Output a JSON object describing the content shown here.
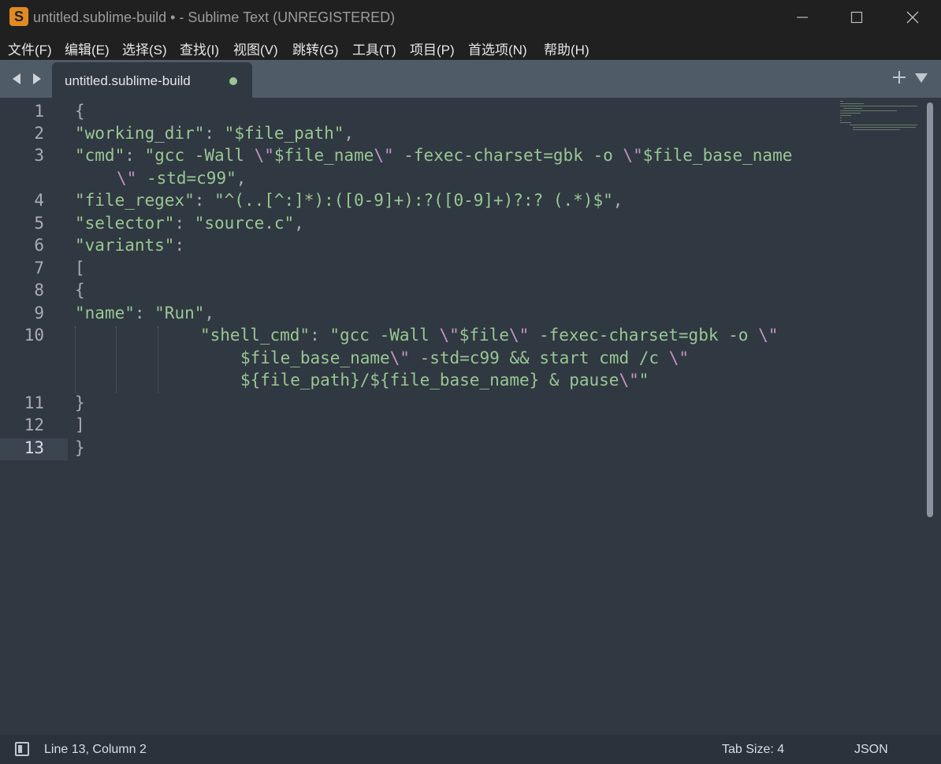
{
  "window": {
    "title": "untitled.sublime-build • - Sublime Text (UNREGISTERED)",
    "app_icon_glyph": "S"
  },
  "menu": [
    "文件(F)",
    "编辑(E)",
    "选择(S)",
    "查找(I)",
    "视图(V)",
    "跳转(G)",
    "工具(T)",
    "项目(P)",
    "首选项(N)",
    "帮助(H)"
  ],
  "tab": {
    "label": "untitled.sublime-build",
    "unsaved": true
  },
  "editor": {
    "line_numbers": [
      "1",
      "2",
      "3",
      "",
      "4",
      "5",
      "6",
      "7",
      "8",
      "9",
      "10",
      "",
      "",
      "11",
      "12",
      "13"
    ],
    "current_line": "13",
    "code": {
      "l1": "{",
      "l2_key": "\"working_dir\"",
      "l2_sep": ": ",
      "l2_val": "\"$file_path\"",
      "l2_end": ",",
      "l3_key": "\"cmd\"",
      "l3_sep": ": ",
      "l3_a": "\"gcc -Wall ",
      "l3_esc1": "\\\"",
      "l3_b": "$file_name",
      "l3_esc2": "\\\"",
      "l3_c": " -fexec-charset=gbk -o ",
      "l3_esc3": "\\\"",
      "l3_d": "$file_base_name",
      "l3w_esc": "\\\"",
      "l3w_a": " -std=c99\"",
      "l3w_end": ",",
      "l4_key": "\"file_regex\"",
      "l4_sep": ": ",
      "l4_val": "\"^(..[^:]*):([0-9]+):?([0-9]+)?:? (.*)$\"",
      "l4_end": ",",
      "l5_key": "\"selector\"",
      "l5_sep": ": ",
      "l5_val": "\"source.c\"",
      "l5_end": ",",
      "l6_key": "\"variants\"",
      "l6_sep": ":",
      "l7": "[",
      "l8": "{",
      "l9_key": "\"name\"",
      "l9_sep": ": ",
      "l9_val": "\"Run\"",
      "l9_end": ",",
      "l10_key": "\"shell_cmd\"",
      "l10_sep": ": ",
      "l10_a": "\"gcc -Wall ",
      "l10_esc1": "\\\"",
      "l10_b": "$file",
      "l10_esc2": "\\\"",
      "l10_c": " -fexec-charset=gbk -o ",
      "l10_esc3": "\\\"",
      "l10w1_a": "$file_base_name",
      "l10w1_esc": "\\\"",
      "l10w1_b": " -std=c99 && start cmd /c ",
      "l10w1_esc2": "\\\"",
      "l10w2_a": "${file_path}/${file_base_name} & pause",
      "l10w2_esc": "\\\"",
      "l10w2_end": "\"",
      "l11": "}",
      "l12": "]",
      "l13": "}"
    }
  },
  "status": {
    "position": "Line 13, Column 2",
    "tab_size": "Tab Size: 4",
    "syntax": "JSON"
  },
  "colors": {
    "string": "#99c794",
    "escape": "#c594c5",
    "punctuation": "#a6acb9",
    "text": "#d8dee9",
    "background": "#303841",
    "tabbar": "#4f5b66",
    "titlebar": "#202020"
  }
}
